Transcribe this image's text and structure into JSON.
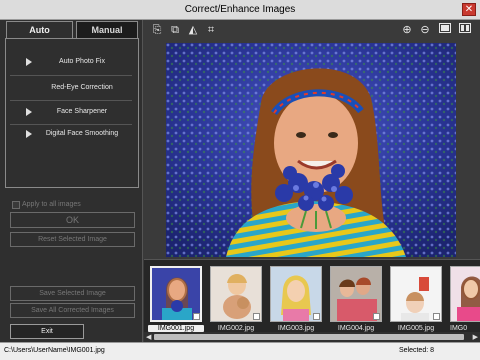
{
  "window": {
    "title": "Correct/Enhance Images"
  },
  "tabs": [
    {
      "label": "Auto"
    },
    {
      "label": "Manual"
    }
  ],
  "auto_panel": {
    "items": [
      {
        "label": "Auto Photo Fix"
      },
      {
        "label": "Red-Eye Correction"
      },
      {
        "label": "Face Sharpener"
      },
      {
        "label": "Digital Face Smoothing"
      }
    ],
    "apply_all_label": "Apply to all images",
    "ok_label": "OK",
    "reset_label": "Reset Selected Image"
  },
  "actions": {
    "save_selected_label": "Save Selected Image",
    "save_all_label": "Save All Corrected Images",
    "exit_label": "Exit"
  },
  "toolbar": {
    "icons": [
      "copy-icon",
      "copy-all-icon",
      "compare-icon",
      "crop-icon",
      "zoom-in-icon",
      "zoom-out-icon",
      "single-view-icon",
      "split-view-icon"
    ]
  },
  "filmstrip": {
    "items": [
      {
        "name": "IMG001.jpg",
        "selected": true
      },
      {
        "name": "IMG002.jpg",
        "selected": false
      },
      {
        "name": "IMG003.jpg",
        "selected": false
      },
      {
        "name": "IMG004.jpg",
        "selected": false
      },
      {
        "name": "IMG005.jpg",
        "selected": false
      },
      {
        "name": "IMG0",
        "selected": false
      }
    ]
  },
  "status": {
    "path": "C:\\Users\\UserName\\IMG001.jpg",
    "selected_text": "Selected: 8"
  },
  "colors": {
    "background": "#3a3a3a",
    "panel": "#2f2f2f",
    "accent_stripe_cyan": "#2aa6c8",
    "accent_stripe_yellow": "#e8c81a"
  }
}
